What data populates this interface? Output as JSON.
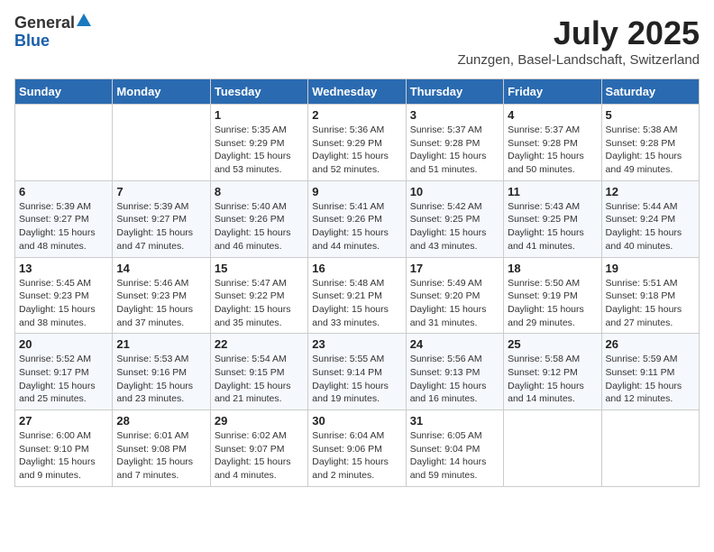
{
  "header": {
    "logo_general": "General",
    "logo_blue": "Blue",
    "main_title": "July 2025",
    "subtitle": "Zunzgen, Basel-Landschaft, Switzerland"
  },
  "calendar": {
    "days_of_week": [
      "Sunday",
      "Monday",
      "Tuesday",
      "Wednesday",
      "Thursday",
      "Friday",
      "Saturday"
    ],
    "weeks": [
      [
        {
          "num": "",
          "detail": ""
        },
        {
          "num": "",
          "detail": ""
        },
        {
          "num": "1",
          "detail": "Sunrise: 5:35 AM\nSunset: 9:29 PM\nDaylight: 15 hours and 53 minutes."
        },
        {
          "num": "2",
          "detail": "Sunrise: 5:36 AM\nSunset: 9:29 PM\nDaylight: 15 hours and 52 minutes."
        },
        {
          "num": "3",
          "detail": "Sunrise: 5:37 AM\nSunset: 9:28 PM\nDaylight: 15 hours and 51 minutes."
        },
        {
          "num": "4",
          "detail": "Sunrise: 5:37 AM\nSunset: 9:28 PM\nDaylight: 15 hours and 50 minutes."
        },
        {
          "num": "5",
          "detail": "Sunrise: 5:38 AM\nSunset: 9:28 PM\nDaylight: 15 hours and 49 minutes."
        }
      ],
      [
        {
          "num": "6",
          "detail": "Sunrise: 5:39 AM\nSunset: 9:27 PM\nDaylight: 15 hours and 48 minutes."
        },
        {
          "num": "7",
          "detail": "Sunrise: 5:39 AM\nSunset: 9:27 PM\nDaylight: 15 hours and 47 minutes."
        },
        {
          "num": "8",
          "detail": "Sunrise: 5:40 AM\nSunset: 9:26 PM\nDaylight: 15 hours and 46 minutes."
        },
        {
          "num": "9",
          "detail": "Sunrise: 5:41 AM\nSunset: 9:26 PM\nDaylight: 15 hours and 44 minutes."
        },
        {
          "num": "10",
          "detail": "Sunrise: 5:42 AM\nSunset: 9:25 PM\nDaylight: 15 hours and 43 minutes."
        },
        {
          "num": "11",
          "detail": "Sunrise: 5:43 AM\nSunset: 9:25 PM\nDaylight: 15 hours and 41 minutes."
        },
        {
          "num": "12",
          "detail": "Sunrise: 5:44 AM\nSunset: 9:24 PM\nDaylight: 15 hours and 40 minutes."
        }
      ],
      [
        {
          "num": "13",
          "detail": "Sunrise: 5:45 AM\nSunset: 9:23 PM\nDaylight: 15 hours and 38 minutes."
        },
        {
          "num": "14",
          "detail": "Sunrise: 5:46 AM\nSunset: 9:23 PM\nDaylight: 15 hours and 37 minutes."
        },
        {
          "num": "15",
          "detail": "Sunrise: 5:47 AM\nSunset: 9:22 PM\nDaylight: 15 hours and 35 minutes."
        },
        {
          "num": "16",
          "detail": "Sunrise: 5:48 AM\nSunset: 9:21 PM\nDaylight: 15 hours and 33 minutes."
        },
        {
          "num": "17",
          "detail": "Sunrise: 5:49 AM\nSunset: 9:20 PM\nDaylight: 15 hours and 31 minutes."
        },
        {
          "num": "18",
          "detail": "Sunrise: 5:50 AM\nSunset: 9:19 PM\nDaylight: 15 hours and 29 minutes."
        },
        {
          "num": "19",
          "detail": "Sunrise: 5:51 AM\nSunset: 9:18 PM\nDaylight: 15 hours and 27 minutes."
        }
      ],
      [
        {
          "num": "20",
          "detail": "Sunrise: 5:52 AM\nSunset: 9:17 PM\nDaylight: 15 hours and 25 minutes."
        },
        {
          "num": "21",
          "detail": "Sunrise: 5:53 AM\nSunset: 9:16 PM\nDaylight: 15 hours and 23 minutes."
        },
        {
          "num": "22",
          "detail": "Sunrise: 5:54 AM\nSunset: 9:15 PM\nDaylight: 15 hours and 21 minutes."
        },
        {
          "num": "23",
          "detail": "Sunrise: 5:55 AM\nSunset: 9:14 PM\nDaylight: 15 hours and 19 minutes."
        },
        {
          "num": "24",
          "detail": "Sunrise: 5:56 AM\nSunset: 9:13 PM\nDaylight: 15 hours and 16 minutes."
        },
        {
          "num": "25",
          "detail": "Sunrise: 5:58 AM\nSunset: 9:12 PM\nDaylight: 15 hours and 14 minutes."
        },
        {
          "num": "26",
          "detail": "Sunrise: 5:59 AM\nSunset: 9:11 PM\nDaylight: 15 hours and 12 minutes."
        }
      ],
      [
        {
          "num": "27",
          "detail": "Sunrise: 6:00 AM\nSunset: 9:10 PM\nDaylight: 15 hours and 9 minutes."
        },
        {
          "num": "28",
          "detail": "Sunrise: 6:01 AM\nSunset: 9:08 PM\nDaylight: 15 hours and 7 minutes."
        },
        {
          "num": "29",
          "detail": "Sunrise: 6:02 AM\nSunset: 9:07 PM\nDaylight: 15 hours and 4 minutes."
        },
        {
          "num": "30",
          "detail": "Sunrise: 6:04 AM\nSunset: 9:06 PM\nDaylight: 15 hours and 2 minutes."
        },
        {
          "num": "31",
          "detail": "Sunrise: 6:05 AM\nSunset: 9:04 PM\nDaylight: 14 hours and 59 minutes."
        },
        {
          "num": "",
          "detail": ""
        },
        {
          "num": "",
          "detail": ""
        }
      ]
    ]
  }
}
